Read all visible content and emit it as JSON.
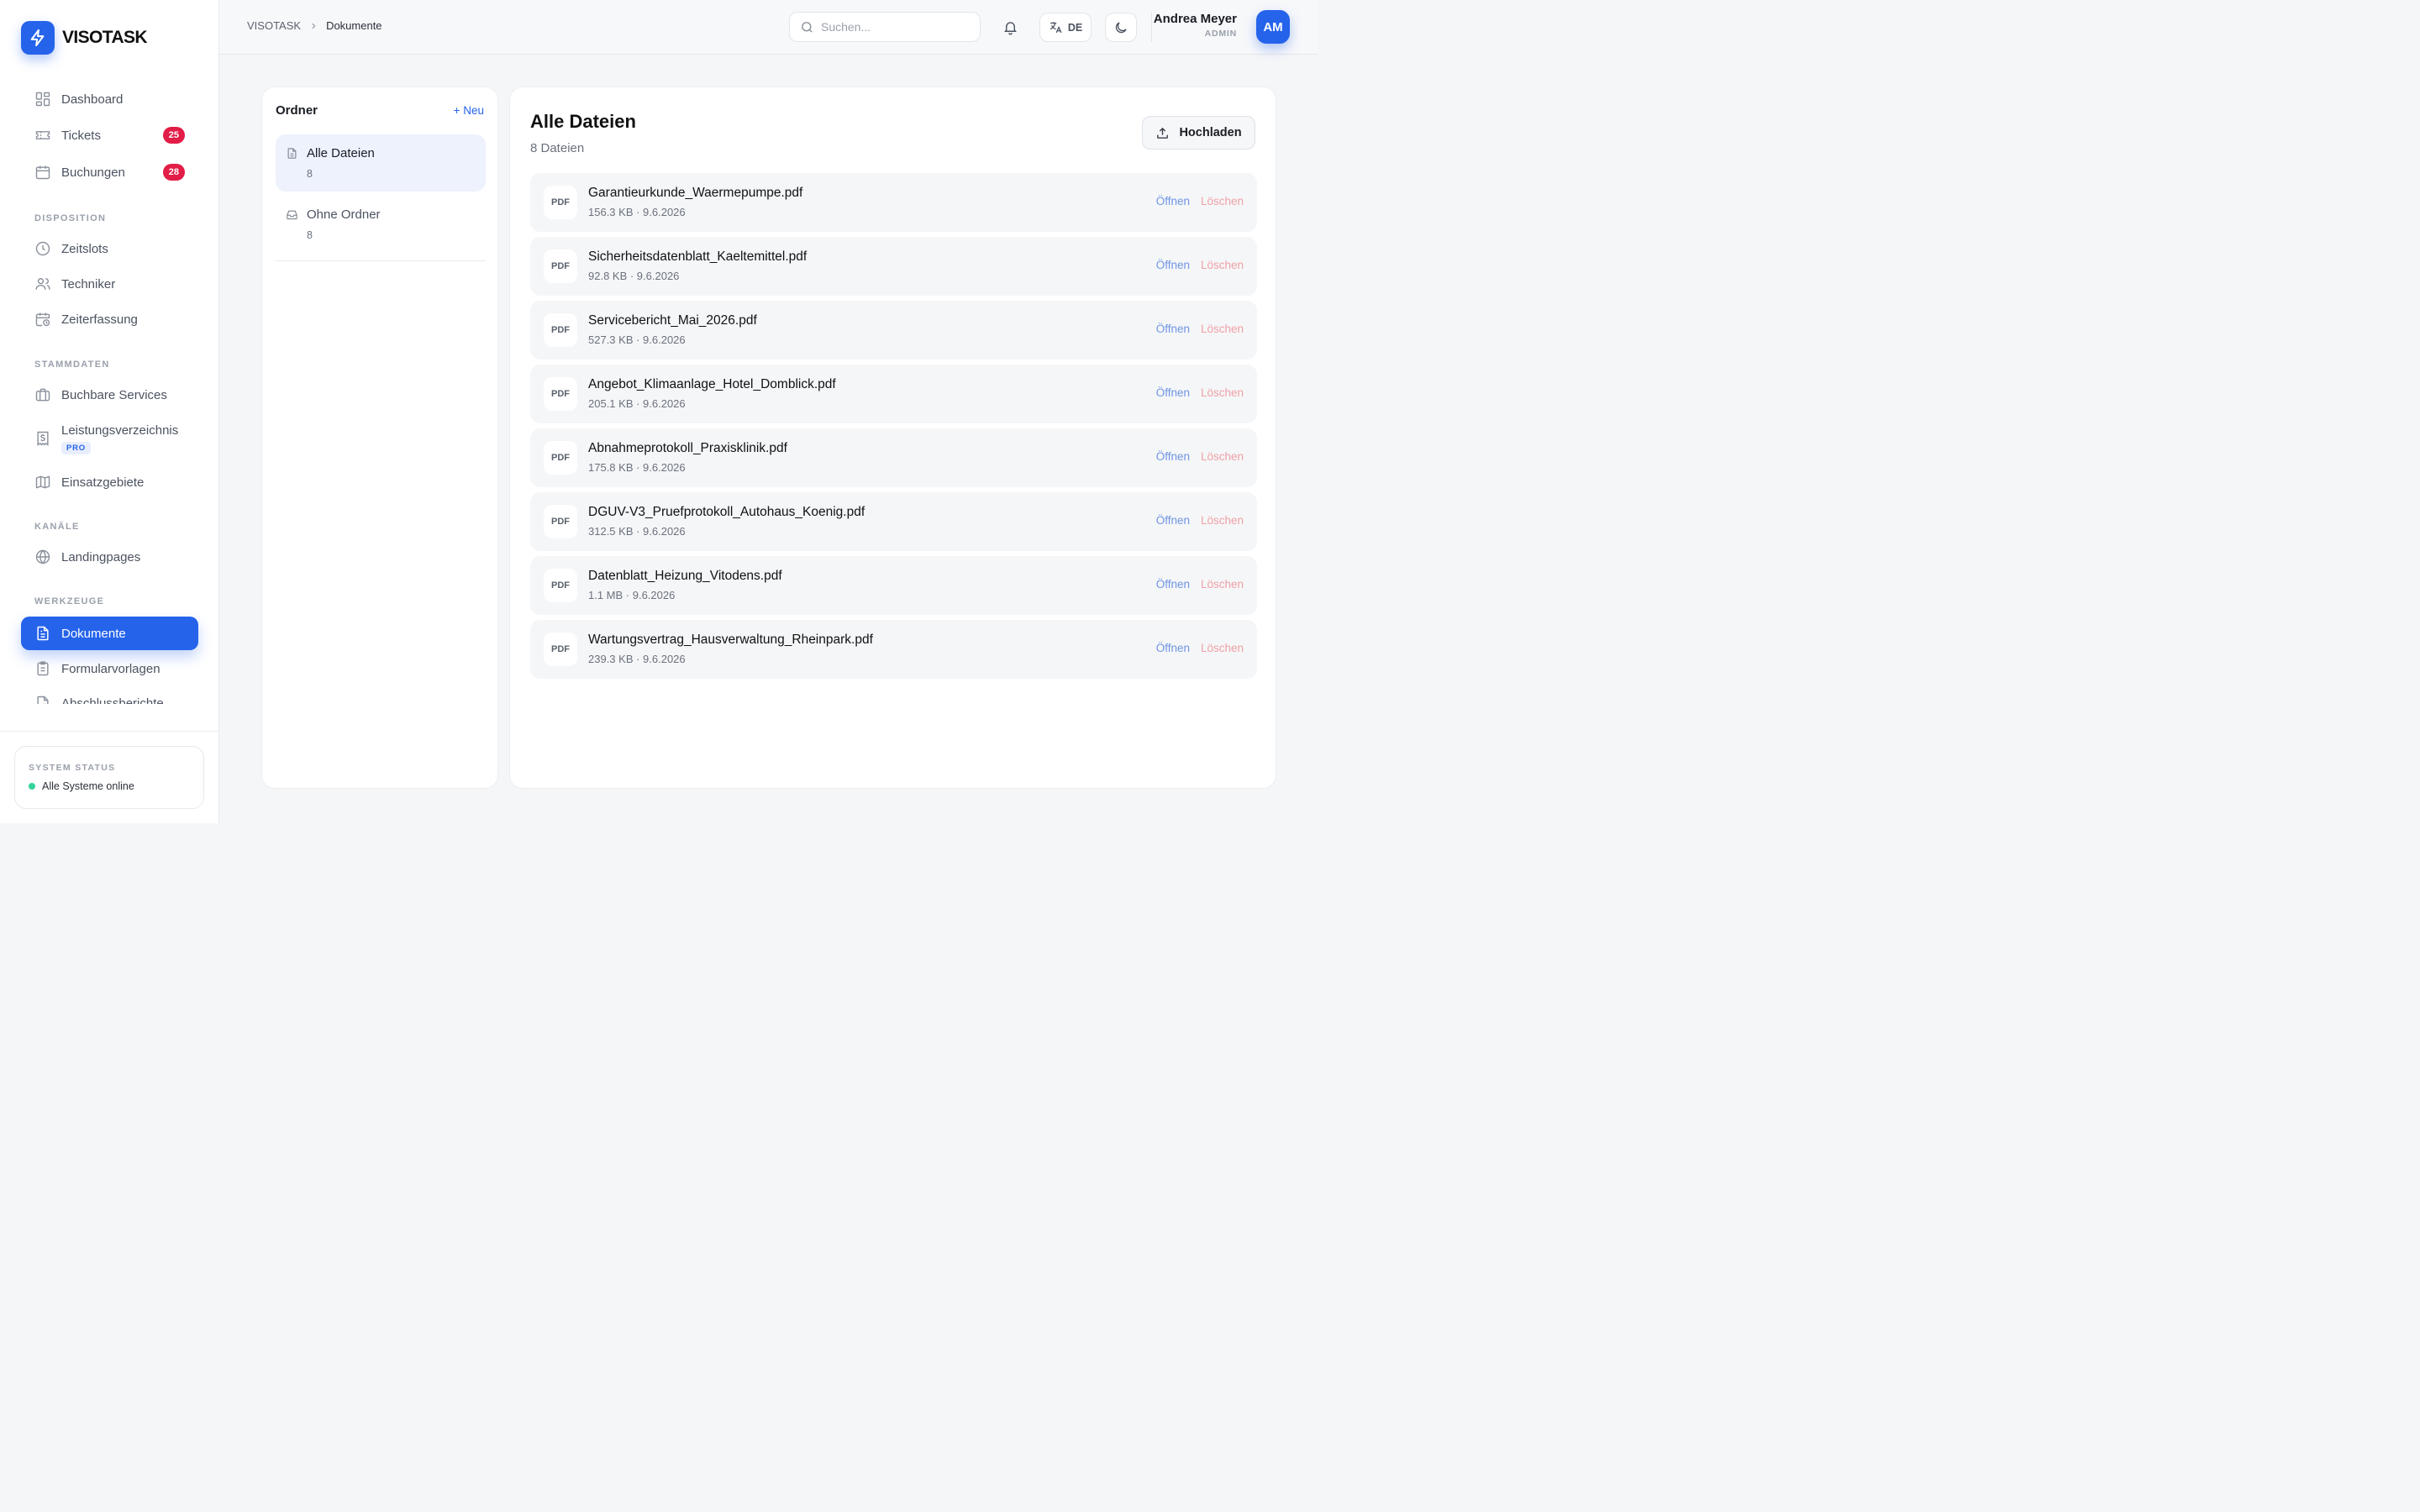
{
  "brand": {
    "name": "VISOTASK",
    "logo_icon": "bolt-icon",
    "accent": "#2563eb"
  },
  "sidebar": {
    "items": [
      {
        "label": "Dashboard",
        "icon": "dashboard-icon"
      },
      {
        "label": "Tickets",
        "icon": "ticket-icon",
        "badge": "25"
      },
      {
        "label": "Buchungen",
        "icon": "calendar-icon",
        "badge": "28"
      }
    ],
    "sections": [
      {
        "title": "DISPOSITION",
        "items": [
          {
            "label": "Zeitslots",
            "icon": "clock-icon"
          },
          {
            "label": "Techniker",
            "icon": "users-icon"
          },
          {
            "label": "Zeiterfassung",
            "icon": "calendar-clock-icon"
          }
        ]
      },
      {
        "title": "STAMMDATEN",
        "items": [
          {
            "label": "Buchbare Services",
            "icon": "briefcase-icon"
          },
          {
            "label": "Leistungsverzeichnis",
            "icon": "receipt-icon",
            "tag": "PRO"
          },
          {
            "label": "Einsatzgebiete",
            "icon": "map-icon"
          }
        ]
      },
      {
        "title": "KANÄLE",
        "items": [
          {
            "label": "Landingpages",
            "icon": "globe-icon"
          }
        ]
      },
      {
        "title": "WERKZEUGE",
        "items": [
          {
            "label": "Dokumente",
            "icon": "document-icon",
            "active": true
          },
          {
            "label": "Formularvorlagen",
            "icon": "clipboard-icon"
          },
          {
            "label": "Abschlussberichte",
            "icon": "report-icon"
          }
        ]
      }
    ],
    "status": {
      "title": "SYSTEM STATUS",
      "text": "Alle Systeme online",
      "color": "#34d399"
    }
  },
  "header": {
    "breadcrumb": [
      "VISOTASK",
      "Dokumente"
    ],
    "search_placeholder": "Suchen...",
    "language": "DE",
    "user": {
      "name": "Andrea Meyer",
      "role": "ADMIN",
      "initials": "AM"
    }
  },
  "folders": {
    "title": "Ordner",
    "new_label": "+ Neu",
    "items": [
      {
        "label": "Alle Dateien",
        "count": "8",
        "icon": "file-icon",
        "active": true
      },
      {
        "label": "Ohne Ordner",
        "count": "8",
        "icon": "inbox-icon"
      }
    ]
  },
  "files": {
    "title": "Alle Dateien",
    "count_label": "8 Dateien",
    "upload_label": "Hochladen",
    "open_label": "Öffnen",
    "delete_label": "Löschen",
    "type_label": "PDF",
    "items": [
      {
        "name": "Garantieurkunde_Waermepumpe.pdf",
        "meta": "156.3 KB · 9.6.2026"
      },
      {
        "name": "Sicherheitsdatenblatt_Kaeltemittel.pdf",
        "meta": "92.8 KB · 9.6.2026"
      },
      {
        "name": "Servicebericht_Mai_2026.pdf",
        "meta": "527.3 KB · 9.6.2026"
      },
      {
        "name": "Angebot_Klimaanlage_Hotel_Domblick.pdf",
        "meta": "205.1 KB · 9.6.2026"
      },
      {
        "name": "Abnahmeprotokoll_Praxisklinik.pdf",
        "meta": "175.8 KB · 9.6.2026"
      },
      {
        "name": "DGUV-V3_Pruefprotokoll_Autohaus_Koenig.pdf",
        "meta": "312.5 KB · 9.6.2026"
      },
      {
        "name": "Datenblatt_Heizung_Vitodens.pdf",
        "meta": "1.1 MB · 9.6.2026"
      },
      {
        "name": "Wartungsvertrag_Hausverwaltung_Rheinpark.pdf",
        "meta": "239.3 KB · 9.6.2026"
      }
    ]
  }
}
